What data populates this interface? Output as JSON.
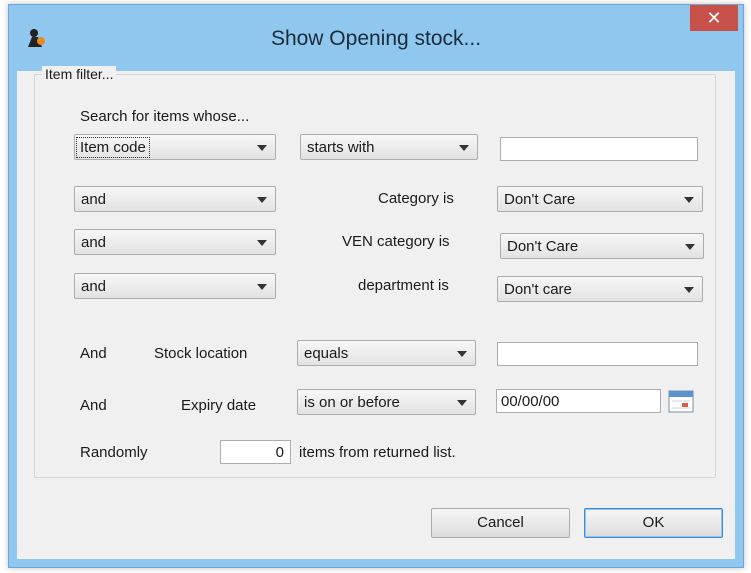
{
  "window": {
    "title": "Show Opening stock...",
    "close_glyph": "✕"
  },
  "item_filter": {
    "legend": "Item filter...",
    "search_heading": "Search for items whose...",
    "row1": {
      "field": "Item code",
      "operator": "starts with",
      "value": ""
    },
    "row2": {
      "conj": "and",
      "label": "Category is",
      "value": "Don't Care"
    },
    "row3": {
      "conj": "and",
      "label": "VEN category is",
      "value": "Don't Care"
    },
    "row4": {
      "conj": "and",
      "label": "department is",
      "value": "Don't care"
    },
    "stock_location": {
      "conj": "And",
      "label": "Stock location",
      "operator": "equals",
      "value": ""
    },
    "expiry_date": {
      "conj": "And",
      "label": "Expiry date",
      "operator": "is on or before",
      "value": "00/00/00"
    },
    "random": {
      "label": "Randomly",
      "count": "0",
      "suffix": "items from returned list."
    }
  },
  "buttons": {
    "cancel": "Cancel",
    "ok": "OK"
  },
  "icons": {
    "app": "app-logo-icon",
    "calendar": "calendar-icon",
    "close": "close-icon"
  }
}
